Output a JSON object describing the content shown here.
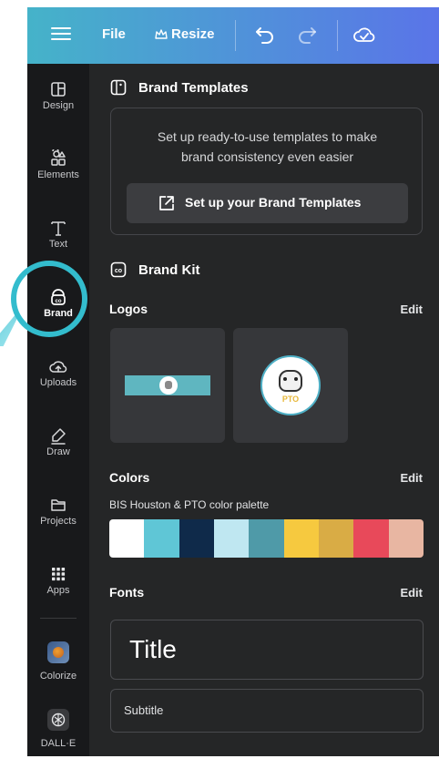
{
  "topbar": {
    "file_label": "File",
    "resize_label": "Resize",
    "icons": [
      "menu-icon",
      "crown-icon",
      "undo-icon",
      "redo-icon",
      "cloud-check-icon"
    ]
  },
  "rail": {
    "items": [
      {
        "label": "Design",
        "icon": "layout-icon"
      },
      {
        "label": "Elements",
        "icon": "shapes-icon"
      },
      {
        "label": "Text",
        "icon": "text-icon"
      },
      {
        "label": "Brand",
        "icon": "brand-icon",
        "active": true
      },
      {
        "label": "Uploads",
        "icon": "cloud-upload-icon"
      },
      {
        "label": "Draw",
        "icon": "pen-icon"
      },
      {
        "label": "Projects",
        "icon": "folder-icon"
      },
      {
        "label": "Apps",
        "icon": "apps-grid-icon"
      },
      {
        "label": "Colorize",
        "icon": "colorize-app-icon"
      },
      {
        "label": "DALL·E",
        "icon": "dalle-app-icon"
      }
    ]
  },
  "brand_templates": {
    "title": "Brand Templates",
    "description_line1": "Set up ready-to-use templates to make",
    "description_line2": "brand consistency even easier",
    "button_label": "Set up your Brand Templates"
  },
  "brand_kit": {
    "title": "Brand Kit",
    "logos": {
      "heading": "Logos",
      "edit_label": "Edit",
      "logo_text": "PTO"
    },
    "colors": {
      "heading": "Colors",
      "edit_label": "Edit",
      "palette_name": "BIS Houston & PTO color palette",
      "swatches": [
        "#ffffff",
        "#5fc6d6",
        "#0f2a4a",
        "#bfe7f1",
        "#4f9aa8",
        "#f6c93f",
        "#d9ac45",
        "#e8495a",
        "#e8b6a2"
      ]
    },
    "fonts": {
      "heading": "Fonts",
      "edit_label": "Edit",
      "title_sample": "Title",
      "subtitle_sample": "Subtitle"
    }
  },
  "colors": {
    "accent": "#33bccd",
    "panel": "#252627",
    "rail": "#18191b"
  }
}
